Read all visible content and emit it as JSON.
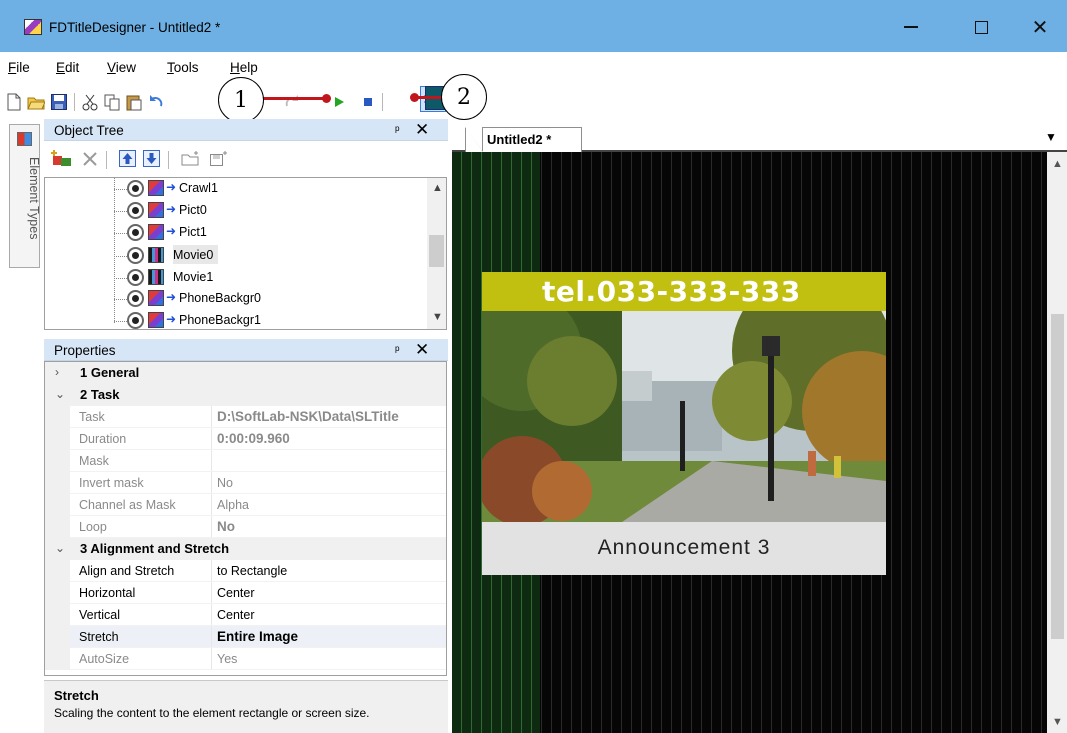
{
  "window": {
    "title": "FDTitleDesigner - Untitled2 *",
    "minimize_glyph": "—",
    "close_glyph": "✕"
  },
  "menu": [
    {
      "label": "File",
      "accel": "F",
      "rest": "ile"
    },
    {
      "label": "Edit",
      "accel": "E",
      "rest": "dit"
    },
    {
      "label": "View",
      "accel": "V",
      "rest": "iew"
    },
    {
      "label": "Tools",
      "accel": "T",
      "rest": "ools"
    },
    {
      "label": "Help",
      "accel": "H",
      "rest": "elp"
    }
  ],
  "callouts": {
    "one": "1",
    "two": "2"
  },
  "side_tab": {
    "label": "Element Types"
  },
  "object_tree": {
    "title": "Object Tree",
    "pin_glyph": "ᵖ",
    "close_glyph": "✕",
    "items": [
      {
        "name": "Crawl1",
        "kind": "pict"
      },
      {
        "name": "Pict0",
        "kind": "pict"
      },
      {
        "name": "Pict1",
        "kind": "pict"
      },
      {
        "name": "Movie0",
        "kind": "movie"
      },
      {
        "name": "Movie1",
        "kind": "movie"
      },
      {
        "name": "PhoneBackgr0",
        "kind": "pict"
      },
      {
        "name": "PhoneBackgr1",
        "kind": "pict"
      }
    ]
  },
  "properties": {
    "title": "Properties",
    "rows": [
      {
        "type": "cat",
        "chev": "›",
        "name": "1 General"
      },
      {
        "type": "cat",
        "chev": "⌄",
        "name": "2 Task"
      },
      {
        "type": "dim-bold",
        "name": "Task",
        "value": "D:\\SoftLab-NSK\\Data\\SLTitle"
      },
      {
        "type": "dim-bold",
        "name": "Duration",
        "value": "0:00:09.960"
      },
      {
        "type": "dim",
        "name": "Mask",
        "value": ""
      },
      {
        "type": "dim",
        "name": "Invert mask",
        "value": "No"
      },
      {
        "type": "dim",
        "name": "Channel as Mask",
        "value": "Alpha"
      },
      {
        "type": "dim-bold",
        "name": "Loop",
        "value": "No"
      },
      {
        "type": "cat",
        "chev": "⌄",
        "name": "3 Alignment and Stretch"
      },
      {
        "type": "normal",
        "name": "Align and Stretch",
        "value": "to Rectangle"
      },
      {
        "type": "normal",
        "name": "Horizontal",
        "value": "Center"
      },
      {
        "type": "normal",
        "name": "Vertical",
        "value": "Center"
      },
      {
        "type": "sel-bold",
        "name": "Stretch",
        "value": "Entire Image"
      },
      {
        "type": "dim",
        "name": "AutoSize",
        "value": "Yes"
      }
    ],
    "description": {
      "title": "Stretch",
      "text": "Scaling the content to the element rectangle or screen size."
    }
  },
  "document": {
    "tab_label": "Untitled2 *",
    "phone_text": "tel.033-333-333",
    "caption_text": "Announcement 3",
    "colors": {
      "phone_bar": "#c1bf0f",
      "caption_bg": "#e2e2e2",
      "canvas": "#060606",
      "canvas_left": "#0e2a10"
    }
  }
}
